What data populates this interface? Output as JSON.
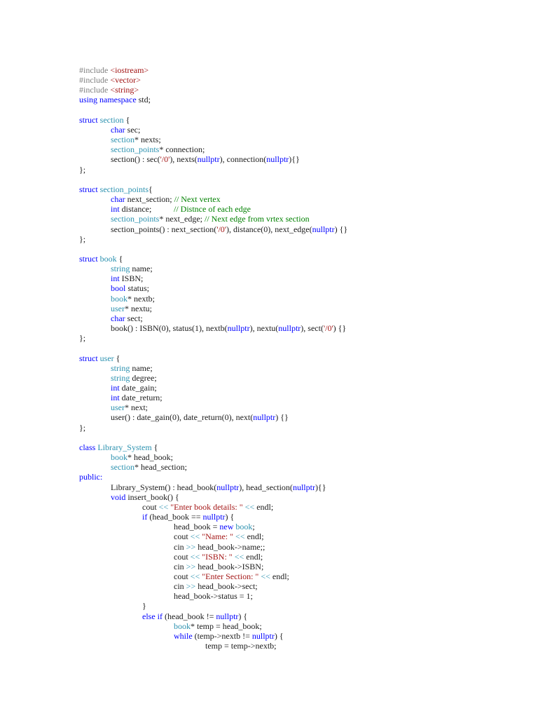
{
  "colors": {
    "preprocessor": "#808080",
    "string": "#a31515",
    "keyword": "#0000ff",
    "type": "#2b91af",
    "comment": "#008000",
    "operator": "#2b91af",
    "text": "#1a1a1a"
  },
  "lines": [
    {
      "i": 0,
      "tokens": [
        {
          "t": "#include ",
          "c": "pp"
        },
        {
          "t": "<iostream>",
          "c": "st"
        }
      ]
    },
    {
      "i": 0,
      "tokens": [
        {
          "t": "#include ",
          "c": "pp"
        },
        {
          "t": "<vector>",
          "c": "st"
        }
      ]
    },
    {
      "i": 0,
      "tokens": [
        {
          "t": "#include ",
          "c": "pp"
        },
        {
          "t": "<string>",
          "c": "st"
        }
      ]
    },
    {
      "i": 0,
      "tokens": [
        {
          "t": "using namespace",
          "c": "kw"
        },
        {
          "t": " std;",
          "c": "tx"
        }
      ]
    },
    {
      "i": 0,
      "tokens": []
    },
    {
      "i": 0,
      "tokens": [
        {
          "t": "struct",
          "c": "kw"
        },
        {
          "t": " section",
          "c": "ty"
        },
        {
          "t": " {",
          "c": "tx"
        }
      ]
    },
    {
      "i": 1,
      "tokens": [
        {
          "t": "char",
          "c": "kw"
        },
        {
          "t": " sec;",
          "c": "tx"
        }
      ]
    },
    {
      "i": 1,
      "tokens": [
        {
          "t": "section",
          "c": "ty"
        },
        {
          "t": "* nexts;",
          "c": "tx"
        }
      ]
    },
    {
      "i": 1,
      "tokens": [
        {
          "t": "section_points",
          "c": "ty"
        },
        {
          "t": "* connection;",
          "c": "tx"
        }
      ]
    },
    {
      "i": 1,
      "tokens": [
        {
          "t": "section() : sec(",
          "c": "tx"
        },
        {
          "t": "'/0'",
          "c": "st"
        },
        {
          "t": "), nexts(",
          "c": "tx"
        },
        {
          "t": "nullptr",
          "c": "kw"
        },
        {
          "t": "), connection(",
          "c": "tx"
        },
        {
          "t": "nullptr",
          "c": "kw"
        },
        {
          "t": "){}",
          "c": "tx"
        }
      ]
    },
    {
      "i": 0,
      "tokens": [
        {
          "t": "};",
          "c": "tx"
        }
      ]
    },
    {
      "i": 0,
      "tokens": []
    },
    {
      "i": 0,
      "tokens": [
        {
          "t": "struct",
          "c": "kw"
        },
        {
          "t": " section_points",
          "c": "ty"
        },
        {
          "t": "{",
          "c": "tx"
        }
      ]
    },
    {
      "i": 1,
      "tokens": [
        {
          "t": "char",
          "c": "kw"
        },
        {
          "t": " next_section; ",
          "c": "tx"
        },
        {
          "t": "// Next vertex",
          "c": "cm"
        }
      ]
    },
    {
      "i": 1,
      "tokens": [
        {
          "t": "int",
          "c": "kw"
        },
        {
          "t": " distance;\t",
          "c": "tx"
        },
        {
          "t": "// Distnce of each edge",
          "c": "cm"
        }
      ]
    },
    {
      "i": 1,
      "tokens": [
        {
          "t": "section_points",
          "c": "ty"
        },
        {
          "t": "* next_edge; ",
          "c": "tx"
        },
        {
          "t": "// Next edge from vrtex section",
          "c": "cm"
        }
      ]
    },
    {
      "i": 1,
      "tokens": [
        {
          "t": "section_points() : next_section(",
          "c": "tx"
        },
        {
          "t": "'/0'",
          "c": "st"
        },
        {
          "t": "), distance(0), next_edge(",
          "c": "tx"
        },
        {
          "t": "nullptr",
          "c": "kw"
        },
        {
          "t": ") {}",
          "c": "tx"
        }
      ]
    },
    {
      "i": 0,
      "tokens": [
        {
          "t": "};",
          "c": "tx"
        }
      ]
    },
    {
      "i": 0,
      "tokens": []
    },
    {
      "i": 0,
      "tokens": [
        {
          "t": "struct",
          "c": "kw"
        },
        {
          "t": " book",
          "c": "ty"
        },
        {
          "t": " {",
          "c": "tx"
        }
      ]
    },
    {
      "i": 1,
      "tokens": [
        {
          "t": "string",
          "c": "ty"
        },
        {
          "t": " name;",
          "c": "tx"
        }
      ]
    },
    {
      "i": 1,
      "tokens": [
        {
          "t": "int",
          "c": "kw"
        },
        {
          "t": " ISBN;",
          "c": "tx"
        }
      ]
    },
    {
      "i": 1,
      "tokens": [
        {
          "t": "bool",
          "c": "kw"
        },
        {
          "t": " status;",
          "c": "tx"
        }
      ]
    },
    {
      "i": 1,
      "tokens": [
        {
          "t": "book",
          "c": "ty"
        },
        {
          "t": "* nextb;",
          "c": "tx"
        }
      ]
    },
    {
      "i": 1,
      "tokens": [
        {
          "t": "user",
          "c": "ty"
        },
        {
          "t": "* nextu;",
          "c": "tx"
        }
      ]
    },
    {
      "i": 1,
      "tokens": [
        {
          "t": "char",
          "c": "kw"
        },
        {
          "t": " sect;",
          "c": "tx"
        }
      ]
    },
    {
      "i": 1,
      "tokens": [
        {
          "t": "book() : ISBN(0), status(1), nextb(",
          "c": "tx"
        },
        {
          "t": "nullptr",
          "c": "kw"
        },
        {
          "t": "), nextu(",
          "c": "tx"
        },
        {
          "t": "nullptr",
          "c": "kw"
        },
        {
          "t": "), sect(",
          "c": "tx"
        },
        {
          "t": "'/0'",
          "c": "st"
        },
        {
          "t": ") {}",
          "c": "tx"
        }
      ]
    },
    {
      "i": 0,
      "tokens": [
        {
          "t": "};",
          "c": "tx"
        }
      ]
    },
    {
      "i": 0,
      "tokens": []
    },
    {
      "i": 0,
      "tokens": [
        {
          "t": "struct",
          "c": "kw"
        },
        {
          "t": " user",
          "c": "ty"
        },
        {
          "t": " {",
          "c": "tx"
        }
      ]
    },
    {
      "i": 1,
      "tokens": [
        {
          "t": "string",
          "c": "ty"
        },
        {
          "t": " name;",
          "c": "tx"
        }
      ]
    },
    {
      "i": 1,
      "tokens": [
        {
          "t": "string",
          "c": "ty"
        },
        {
          "t": " degree;",
          "c": "tx"
        }
      ]
    },
    {
      "i": 1,
      "tokens": [
        {
          "t": "int",
          "c": "kw"
        },
        {
          "t": " date_gain;",
          "c": "tx"
        }
      ]
    },
    {
      "i": 1,
      "tokens": [
        {
          "t": "int",
          "c": "kw"
        },
        {
          "t": " date_return;",
          "c": "tx"
        }
      ]
    },
    {
      "i": 1,
      "tokens": [
        {
          "t": "user",
          "c": "ty"
        },
        {
          "t": "* next;",
          "c": "tx"
        }
      ]
    },
    {
      "i": 1,
      "tokens": [
        {
          "t": "user() : date_gain(0), date_return(0), next(",
          "c": "tx"
        },
        {
          "t": "nullptr",
          "c": "kw"
        },
        {
          "t": ") {}",
          "c": "tx"
        }
      ]
    },
    {
      "i": 0,
      "tokens": [
        {
          "t": "};",
          "c": "tx"
        }
      ]
    },
    {
      "i": 0,
      "tokens": []
    },
    {
      "i": 0,
      "tokens": [
        {
          "t": "class",
          "c": "kw"
        },
        {
          "t": " Library_System",
          "c": "ty"
        },
        {
          "t": " {",
          "c": "tx"
        }
      ]
    },
    {
      "i": 1,
      "tokens": [
        {
          "t": "book",
          "c": "ty"
        },
        {
          "t": "* head_book;",
          "c": "tx"
        }
      ]
    },
    {
      "i": 1,
      "tokens": [
        {
          "t": "section",
          "c": "ty"
        },
        {
          "t": "* head_section;",
          "c": "tx"
        }
      ]
    },
    {
      "i": 0,
      "tokens": [
        {
          "t": "public:",
          "c": "kw"
        }
      ]
    },
    {
      "i": 1,
      "tokens": [
        {
          "t": "Library_System() : head_book(",
          "c": "tx"
        },
        {
          "t": "nullptr",
          "c": "kw"
        },
        {
          "t": "), head_section(",
          "c": "tx"
        },
        {
          "t": "nullptr",
          "c": "kw"
        },
        {
          "t": "){}",
          "c": "tx"
        }
      ]
    },
    {
      "i": 1,
      "tokens": [
        {
          "t": "void",
          "c": "kw"
        },
        {
          "t": " insert_book() {",
          "c": "tx"
        }
      ]
    },
    {
      "i": 2,
      "tokens": [
        {
          "t": "cout ",
          "c": "tx"
        },
        {
          "t": "<<",
          "c": "op"
        },
        {
          "t": " \"Enter book details: \" ",
          "c": "st"
        },
        {
          "t": "<<",
          "c": "op"
        },
        {
          "t": " endl;",
          "c": "tx"
        }
      ]
    },
    {
      "i": 2,
      "tokens": [
        {
          "t": "if",
          "c": "kw"
        },
        {
          "t": " (head_book == ",
          "c": "tx"
        },
        {
          "t": "nullptr",
          "c": "kw"
        },
        {
          "t": ") {",
          "c": "tx"
        }
      ]
    },
    {
      "i": 3,
      "tokens": [
        {
          "t": "head_book = ",
          "c": "tx"
        },
        {
          "t": "new",
          "c": "kw"
        },
        {
          "t": " book",
          "c": "ty"
        },
        {
          "t": ";",
          "c": "tx"
        }
      ]
    },
    {
      "i": 3,
      "tokens": [
        {
          "t": "cout ",
          "c": "tx"
        },
        {
          "t": "<<",
          "c": "op"
        },
        {
          "t": " \"Name: \" ",
          "c": "st"
        },
        {
          "t": "<<",
          "c": "op"
        },
        {
          "t": " endl;",
          "c": "tx"
        }
      ]
    },
    {
      "i": 3,
      "tokens": [
        {
          "t": "cin ",
          "c": "tx"
        },
        {
          "t": ">>",
          "c": "op"
        },
        {
          "t": " head_book->name;;",
          "c": "tx"
        }
      ]
    },
    {
      "i": 3,
      "tokens": [
        {
          "t": "cout ",
          "c": "tx"
        },
        {
          "t": "<<",
          "c": "op"
        },
        {
          "t": " \"ISBN: \" ",
          "c": "st"
        },
        {
          "t": "<<",
          "c": "op"
        },
        {
          "t": " endl;",
          "c": "tx"
        }
      ]
    },
    {
      "i": 3,
      "tokens": [
        {
          "t": "cin ",
          "c": "tx"
        },
        {
          "t": ">>",
          "c": "op"
        },
        {
          "t": " head_book->ISBN;",
          "c": "tx"
        }
      ]
    },
    {
      "i": 3,
      "tokens": [
        {
          "t": "cout ",
          "c": "tx"
        },
        {
          "t": "<<",
          "c": "op"
        },
        {
          "t": " \"Enter Section: \" ",
          "c": "st"
        },
        {
          "t": "<<",
          "c": "op"
        },
        {
          "t": " endl;",
          "c": "tx"
        }
      ]
    },
    {
      "i": 3,
      "tokens": [
        {
          "t": "cin ",
          "c": "tx"
        },
        {
          "t": ">>",
          "c": "op"
        },
        {
          "t": " head_book->sect;",
          "c": "tx"
        }
      ]
    },
    {
      "i": 3,
      "tokens": [
        {
          "t": "head_book->status = 1;",
          "c": "tx"
        }
      ]
    },
    {
      "i": 2,
      "tokens": [
        {
          "t": "}",
          "c": "tx"
        }
      ]
    },
    {
      "i": 2,
      "tokens": [
        {
          "t": "else if",
          "c": "kw"
        },
        {
          "t": " (head_book != ",
          "c": "tx"
        },
        {
          "t": "nullptr",
          "c": "kw"
        },
        {
          "t": ") {",
          "c": "tx"
        }
      ]
    },
    {
      "i": 3,
      "tokens": [
        {
          "t": "book",
          "c": "ty"
        },
        {
          "t": "* temp = head_book;",
          "c": "tx"
        }
      ]
    },
    {
      "i": 3,
      "tokens": [
        {
          "t": "while",
          "c": "kw"
        },
        {
          "t": " (temp->nextb != ",
          "c": "tx"
        },
        {
          "t": "nullptr",
          "c": "kw"
        },
        {
          "t": ") {",
          "c": "tx"
        }
      ]
    },
    {
      "i": 4,
      "tokens": [
        {
          "t": "temp = temp->nextb;",
          "c": "tx"
        }
      ]
    }
  ]
}
